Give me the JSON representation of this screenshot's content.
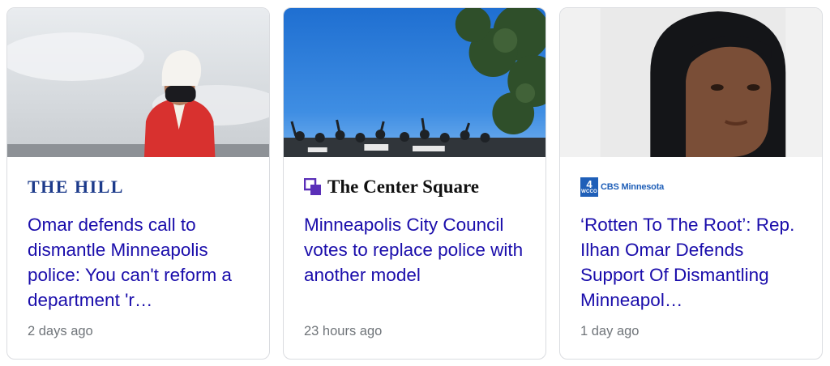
{
  "cards": [
    {
      "source": "THE HILL",
      "title": "Omar defends call to dismantle Minneapolis police: You can't reform a department 'r…",
      "time": "2 days ago"
    },
    {
      "source": "The Center Square",
      "title": "Minneapolis City Council votes to replace police with another model",
      "time": "23 hours ago"
    },
    {
      "source": "CBS Minnesota",
      "source_badge_number": "4",
      "source_badge_callsign": "WCCO",
      "title": "‘Rotten To The Root’: Rep. Ilhan Omar Defends Support Of Dismantling Minneapol…",
      "time": "1 day ago"
    }
  ],
  "colors": {
    "title_link": "#1a0dab",
    "timestamp": "#70757a",
    "hill_logo": "#1d3b8b",
    "tcs_icon": "#5a2fb8",
    "cbs_blue": "#1f5fb8"
  }
}
